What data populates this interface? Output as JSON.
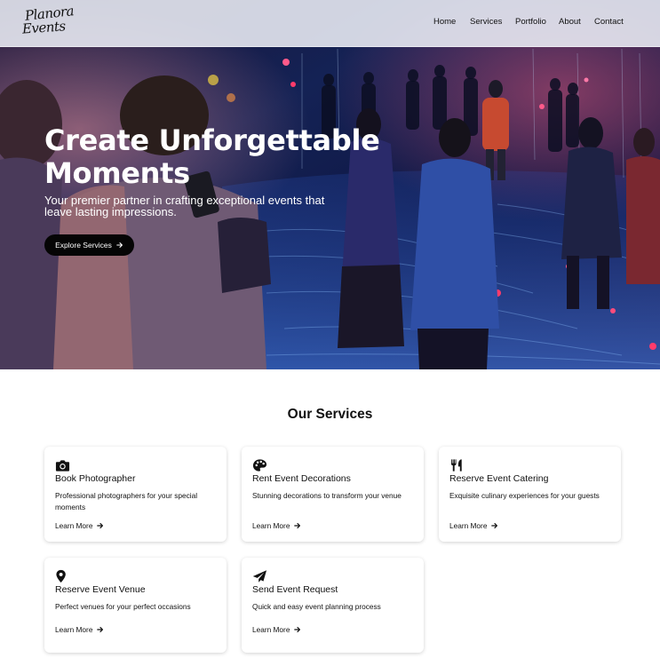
{
  "brand": {
    "logo_line1": "Planora",
    "logo_line2": "Events"
  },
  "nav": {
    "items": [
      {
        "label": "Home"
      },
      {
        "label": "Services"
      },
      {
        "label": "Portfolio"
      },
      {
        "label": "About"
      },
      {
        "label": "Contact"
      }
    ]
  },
  "hero": {
    "title": "Create Unforgettable Moments",
    "subtitle": "Your premier partner in crafting exceptional events that leave lasting impressions.",
    "cta_label": "Explore Services",
    "cta_icon": "arrow-right-icon"
  },
  "services": {
    "heading": "Our Services",
    "link_label": "Learn More",
    "items": [
      {
        "icon": "camera-icon",
        "title": "Book Photographer",
        "description": "Professional photographers for your special moments",
        "link": "Learn More"
      },
      {
        "icon": "palette-icon",
        "title": "Rent Event Decorations",
        "description": "Stunning decorations to transform your venue",
        "link": "Learn More"
      },
      {
        "icon": "utensils-icon",
        "title": "Reserve Event Catering",
        "description": "Exquisite culinary experiences for your guests",
        "link": "Learn More"
      },
      {
        "icon": "map-marker-icon",
        "title": "Reserve Event Venue",
        "description": "Perfect venues for your perfect occasions",
        "link": "Learn More"
      },
      {
        "icon": "paper-plane-icon",
        "title": "Send Event Request",
        "description": "Quick and easy event planning process",
        "link": "Learn More"
      }
    ]
  },
  "colors": {
    "navbar_bg": "#eceef6",
    "cta_bg": "#050505",
    "hero_text": "#ffffff",
    "page_bg": "#ffffff"
  }
}
